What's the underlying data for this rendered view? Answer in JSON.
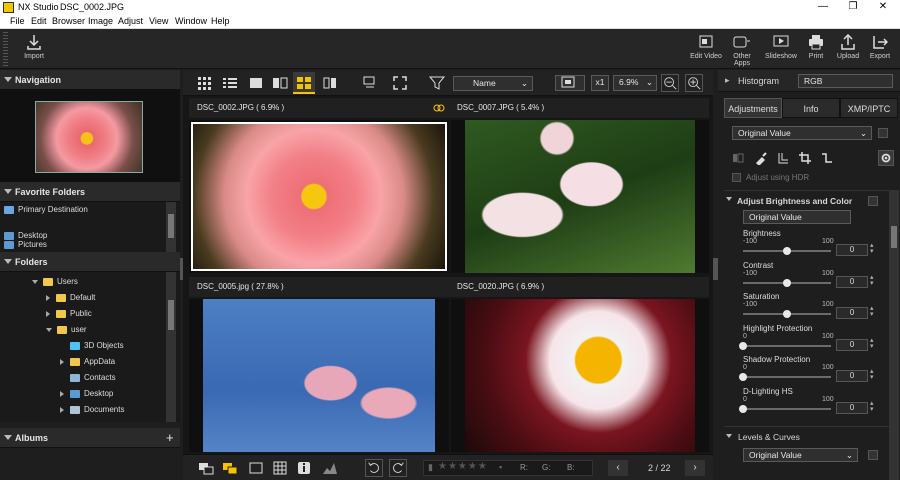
{
  "window": {
    "app_name": "NX Studio",
    "file_name": "DSC_0002.JPG",
    "min": "—",
    "max": "❐",
    "close": "✕"
  },
  "menu": [
    "File",
    "Edit",
    "Browser",
    "Image",
    "Adjust",
    "View",
    "Window",
    "Help"
  ],
  "toolbar": {
    "import": "Import",
    "edit_video": "Edit Video",
    "other_apps": "Other Apps",
    "slideshow": "Slideshow",
    "print": "Print",
    "upload": "Upload",
    "export": "Export"
  },
  "left": {
    "navigation": "Navigation",
    "favorite_folders": "Favorite Folders",
    "favorites": [
      "Primary Destination",
      "Desktop",
      "Pictures"
    ],
    "folders": "Folders",
    "tree": [
      "Users",
      "Default",
      "Public",
      "user",
      "3D Objects",
      "AppData",
      "Contacts",
      "Desktop",
      "Documents"
    ],
    "albums": "Albums",
    "albums_add": "+"
  },
  "viewbar": {
    "sort": "Name",
    "zoom_x1": "x1",
    "zoom": "6.9%"
  },
  "images": [
    {
      "label": "DSC_0002.JPG ( 6.9% )"
    },
    {
      "label": "DSC_0007.JPG ( 5.4% )"
    },
    {
      "label": "DSC_0005.jpg ( 27.8% )"
    },
    {
      "label": "DSC_0020.JPG ( 6.9% )"
    }
  ],
  "bottombar": {
    "r": "R:",
    "g": "G:",
    "b": "B:",
    "page": "2 / 22"
  },
  "right": {
    "histogram": "Histogram",
    "histogram_mode": "RGB",
    "tabs": [
      "Adjustments",
      "Info",
      "XMP/IPTC"
    ],
    "preset": "Original Value",
    "adjust_hdr": "Adjust using HDR",
    "section1": "Adjust Brightness and Color",
    "section1_preset": "Original Value",
    "sliders": [
      {
        "label": "Brightness",
        "min": "-100",
        "max": "100",
        "value": "0",
        "level": 0.5
      },
      {
        "label": "Contrast",
        "min": "-100",
        "max": "100",
        "value": "0",
        "level": 0.5
      },
      {
        "label": "Saturation",
        "min": "-100",
        "max": "100",
        "value": "0",
        "level": 0.5
      },
      {
        "label": "Highlight Protection",
        "min": "0",
        "max": "100",
        "value": "0",
        "level": 0
      },
      {
        "label": "Shadow Protection",
        "min": "0",
        "max": "100",
        "value": "0",
        "level": 0
      },
      {
        "label": "D-Lighting HS",
        "min": "0",
        "max": "100",
        "value": "0",
        "level": 0
      }
    ],
    "section2": "Levels & Curves",
    "section2_preset": "Original Value"
  },
  "colors": {
    "accent_yellow": "#f5c400"
  }
}
